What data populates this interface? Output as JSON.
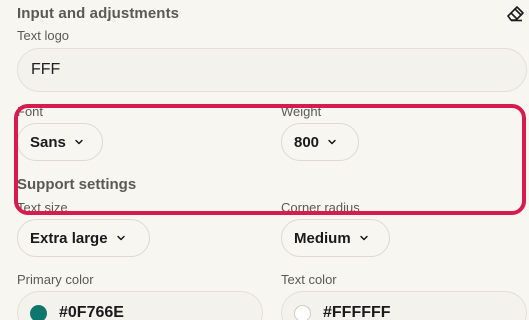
{
  "panel": {
    "title": "Input and adjustments",
    "reset_icon": "eraser-icon"
  },
  "text_logo": {
    "label": "Text logo",
    "value": "FFF"
  },
  "font": {
    "label": "Font",
    "value": "Sans",
    "icon": "chevron-down-icon"
  },
  "weight": {
    "label": "Weight",
    "value": "800",
    "icon": "chevron-down-icon"
  },
  "support": {
    "title": "Support settings"
  },
  "text_size": {
    "label": "Text size",
    "value": "Extra large",
    "icon": "chevron-down-icon"
  },
  "corner_radius": {
    "label": "Corner radius",
    "value": "Medium",
    "icon": "chevron-down-icon"
  },
  "primary_color": {
    "label": "Primary color",
    "value": "#0F766E",
    "swatch": "#0F766E"
  },
  "text_color": {
    "label": "Text color",
    "value": "#FFFFFF",
    "swatch": "#FFFFFF"
  },
  "annotation": {
    "highlight_color": "#D81B4F"
  }
}
